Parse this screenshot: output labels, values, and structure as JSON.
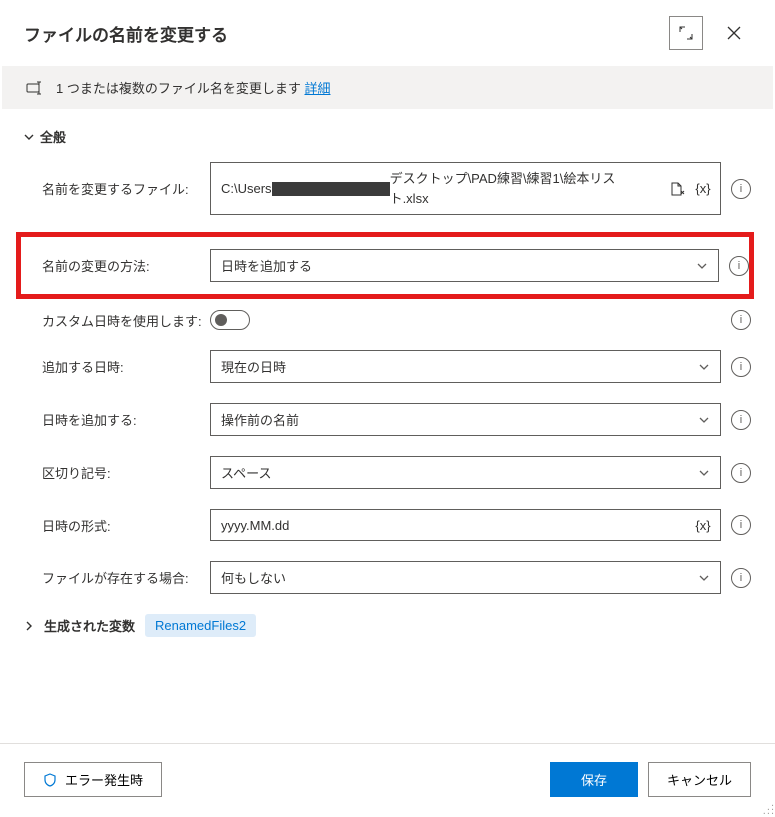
{
  "header": {
    "title": "ファイルの名前を変更する"
  },
  "banner": {
    "text": "1 つまたは複数のファイル名を変更します",
    "link": "詳細"
  },
  "section_general": {
    "title": "全般"
  },
  "fields": {
    "file_label": "名前を変更するファイル:",
    "file_value_pre": "C:\\Users",
    "file_value_post": "デスクトップ\\PAD練習\\練習1\\絵本リスト.xlsx",
    "method_label": "名前の変更の方法:",
    "method_value": "日時を追加する",
    "custom_dt_label": "カスタム日時を使用します:",
    "add_dt_label": "追加する日時:",
    "add_dt_value": "現在の日時",
    "where_label": "日時を追加する:",
    "where_value": "操作前の名前",
    "sep_label": "区切り記号:",
    "sep_value": "スペース",
    "format_label": "日時の形式:",
    "format_value": "yyyy.MM.dd",
    "exists_label": "ファイルが存在する場合:",
    "exists_value": "何もしない"
  },
  "variables": {
    "label": "生成された変数",
    "chip": "RenamedFiles2"
  },
  "footer": {
    "error_btn": "エラー発生時",
    "save": "保存",
    "cancel": "キャンセル"
  },
  "var_token": "{x}"
}
